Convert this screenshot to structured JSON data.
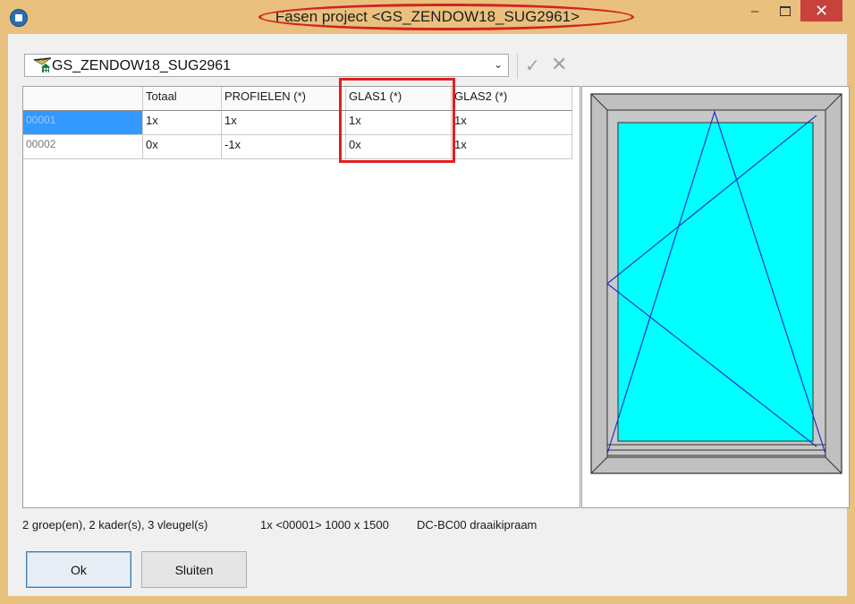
{
  "window": {
    "title": "Fasen project <GS_ZENDOW18_SUG2961>",
    "minimize_glyph": "–",
    "close_glyph": "✕"
  },
  "toolbar": {
    "project_combo_value": "GS_ZENDOW18_SUG2961",
    "combo_arrow_glyph": "⌄",
    "accept_glyph": "✓",
    "cancel_glyph": "✕"
  },
  "grid": {
    "columns": [
      "",
      "Totaal",
      "PROFIELEN (*)",
      "GLAS1 (*)",
      "GLAS2 (*)"
    ],
    "rows": [
      {
        "id": "00001",
        "totaal": "1x",
        "profielen": "1x",
        "glas1": "1x",
        "glas2": "1x"
      },
      {
        "id": "00002",
        "totaal": "0x",
        "profielen": "-1x",
        "glas1": "0x",
        "glas2": "1x"
      }
    ]
  },
  "preview": {
    "description_icon": "window-tilt-turn-icon",
    "frame_color": "#c0c0c0",
    "glass_color": "#00ffff",
    "line_color": "#2030c8"
  },
  "status": {
    "summary": "2 groep(en), 2 kader(s), 3 vleugel(s)",
    "element": "1x <00001> 1000 x 1500",
    "type": "DC-BC00 draaikipraam"
  },
  "buttons": {
    "ok": "Ok",
    "sluiten": "Sluiten"
  },
  "colors": {
    "titlebar": "#e9c07d",
    "close_button": "#c8413a",
    "selection": "#3399ff",
    "annotation": "#e02020"
  }
}
